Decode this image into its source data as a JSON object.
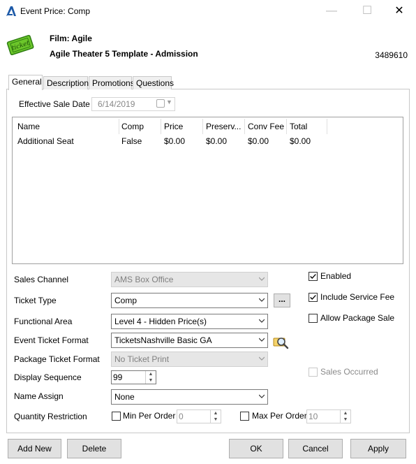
{
  "window": {
    "title": "Event Price: Comp",
    "minimize": "—",
    "maximize": "☐",
    "close": "✕"
  },
  "header": {
    "film": "Film: Agile",
    "template": "Agile Theater 5 Template - Admission",
    "id": "3489610",
    "ticket_icon_text": "ticket"
  },
  "tabs": [
    "General",
    "Description",
    "Promotions",
    "Questions"
  ],
  "effective_sale_date": {
    "label": "Effective Sale Date",
    "value": "6/14/2019"
  },
  "grid": {
    "columns": [
      "Name",
      "Comp",
      "Price",
      "Preserv...",
      "Conv Fee",
      "Total"
    ],
    "rows": [
      [
        "Additional Seat",
        "False",
        "$0.00",
        "$0.00",
        "$0.00",
        "$0.00"
      ]
    ]
  },
  "form": {
    "sales_channel": {
      "label": "Sales Channel",
      "value": "AMS Box Office"
    },
    "ticket_type": {
      "label": "Ticket Type",
      "value": "Comp",
      "ellipsis": "..."
    },
    "functional_area": {
      "label": "Functional Area",
      "value": "Level 4 - Hidden Price(s)"
    },
    "event_ticket_format": {
      "label": "Event Ticket Format",
      "value": "TicketsNashville Basic GA"
    },
    "package_ticket_format": {
      "label": "Package Ticket Format",
      "value": "No Ticket Print"
    },
    "display_sequence": {
      "label": "Display Sequence",
      "value": "99"
    },
    "name_assign": {
      "label": "Name Assign",
      "value": "None"
    },
    "quantity_restriction": {
      "label": "Quantity Restriction",
      "min_label": "Min Per Order",
      "min_value": "0",
      "max_label": "Max Per Order",
      "max_value": "10"
    }
  },
  "checkboxes": {
    "enabled": {
      "label": "Enabled",
      "checked": true
    },
    "include_service_fee": {
      "label": "Include Service Fee",
      "checked": true
    },
    "allow_package_sale": {
      "label": "Allow Package Sale",
      "checked": false
    },
    "sales_occurred": {
      "label": "Sales Occurred",
      "checked": false
    }
  },
  "buttons": {
    "add_new": "Add New",
    "delete": "Delete",
    "ok": "OK",
    "cancel": "Cancel",
    "apply": "Apply"
  },
  "colors": {
    "accent_blue": "#1e5aa8",
    "ticket_green": "#6cc62a"
  }
}
